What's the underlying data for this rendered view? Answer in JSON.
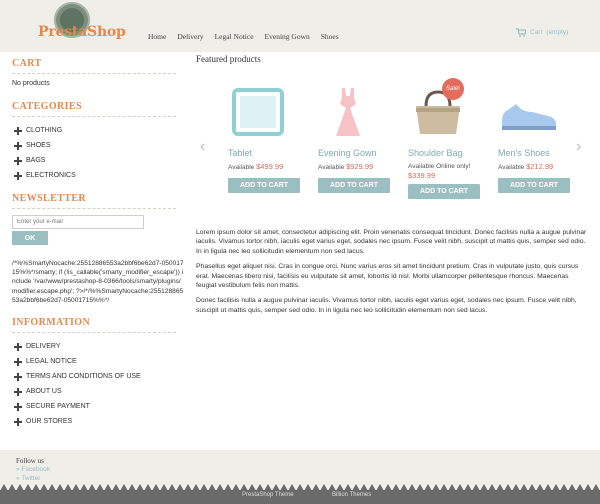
{
  "header": {
    "logo_text": "PrestaShop",
    "nav": [
      "Home",
      "Delivery",
      "Legal Notice",
      "Evening Gown",
      "Shoes"
    ],
    "cart_label": "Cart",
    "cart_status": "(empty)"
  },
  "sidebar": {
    "cart": {
      "title": "CART",
      "empty_text": "No products"
    },
    "categories": {
      "title": "CATEGORIES",
      "items": [
        "CLOTHING",
        "SHOES",
        "BAGS",
        "ELECTRONICS"
      ]
    },
    "newsletter": {
      "title": "NEWSLETTER",
      "placeholder": "Enter your e-mail",
      "button": "OK"
    },
    "smarty_text": "/*%%SmartyNocache:25512886553a2bbf6be62d7-05001715%%*/smarty; if (!is_callable('smarty_modifier_escape')) include '/var/www/prestashop-8-0366/tools/smarty/plugins/modifier.escape.php'; ?>/*/%%SmartyNocache:25512886553a2bbf6be62d7-05001715%%*/",
    "information": {
      "title": "INFORMATION",
      "items": [
        "DELIVERY",
        "LEGAL NOTICE",
        "TERMS AND CONDITIONS OF USE",
        "ABOUT US",
        "SECURE PAYMENT",
        "OUR STORES"
      ]
    }
  },
  "main": {
    "featured_title": "Featured products",
    "products": [
      {
        "name": "Tablet",
        "availability": "Available",
        "price": "$499.99",
        "button": "ADD TO CART",
        "sale": "",
        "icon": "tablet-icon"
      },
      {
        "name": "Evening Gown",
        "availability": "Available",
        "price": "$929.99",
        "button": "ADD TO CART",
        "sale": "",
        "icon": "dress-icon"
      },
      {
        "name": "Shoulder Bag",
        "availability": "Available Online only!",
        "price": "$339.99",
        "button": "ADD TO CART",
        "sale": "Sale!",
        "icon": "bag-icon"
      },
      {
        "name": "Men's Shoes",
        "availability": "Available",
        "price": "$212.99",
        "button": "ADD TO CART",
        "sale": "",
        "icon": "shoe-icon"
      }
    ],
    "paragraphs": [
      "Lorem ipsum dolor sit amet, consectetur adipiscing elit. Proin venenatis consequat tincidunt. Donec facilisis nulla a augue pulvinar iaculis. Vivamus tortor nibh, iaculis eget varius eget, sodales nec ipsum. Fusce velit nibh, suscipit ut mattis quis, semper sed odio. In in ligula nec leo sollicitudin elementum non sed lacus.",
      "Phasellus eget aliquet nisi. Cras in congue orci. Nunc varius eros sit amet tincidunt pretium. Cras in vulputate justo, quis cursus erat. Maecenas libero nisi, facilisis eu vulputate sit amet, lobortis id nisl. Morbi ullamcorper pellentesque rhoncus. Maecenas feugiat vestibulum felis non mattis.",
      "Donec facilisis nulla a augue pulvinar iaculis. Vivamus tortor nibh, iaculis eget varius eget, sodales nec ipsum. Fusce velit nibh, suscipit ut mattis quis, semper sed odio. In in ligula nec leo sollicitudin elementum non sed lacus."
    ]
  },
  "footer": {
    "follow": "Follow us",
    "facebook": "» Facebook",
    "twitter": "» Twitter",
    "credit_left": "PrestaShop Theme",
    "credit_right": "Billion Themes"
  },
  "colors": {
    "accent": "#e4894b",
    "button": "#9bbfc0",
    "price": "#d96b5a",
    "sale": "#e36c5c",
    "link": "#7fa9b0"
  }
}
